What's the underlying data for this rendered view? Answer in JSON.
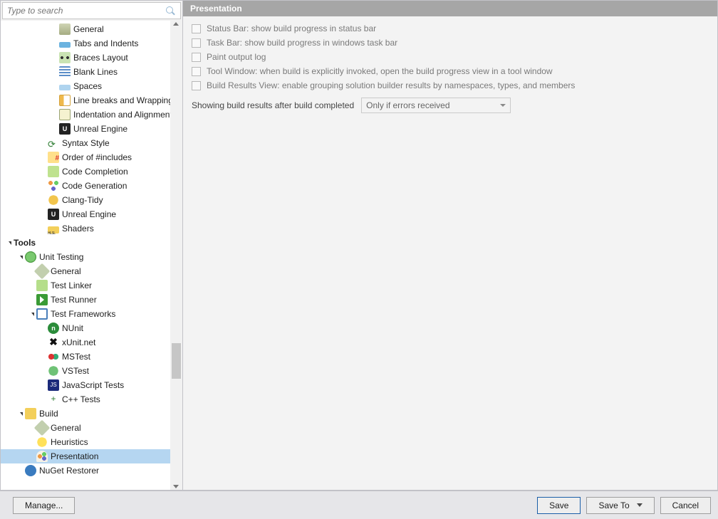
{
  "search": {
    "placeholder": "Type to search"
  },
  "tree": [
    {
      "d": 4,
      "icon": "i-gen",
      "label": "General"
    },
    {
      "d": 4,
      "icon": "i-tabs",
      "label": "Tabs and Indents"
    },
    {
      "d": 4,
      "icon": "i-braces",
      "label": "Braces Layout"
    },
    {
      "d": 4,
      "icon": "i-blank",
      "label": "Blank Lines"
    },
    {
      "d": 4,
      "icon": "i-spaces",
      "label": "Spaces"
    },
    {
      "d": 4,
      "icon": "i-wrap",
      "label": "Line breaks and Wrapping"
    },
    {
      "d": 4,
      "icon": "i-indent",
      "label": "Indentation and Alignment"
    },
    {
      "d": 4,
      "icon": "i-ue",
      "label": "Unreal Engine",
      "iconText": "U"
    },
    {
      "d": 3,
      "icon": "i-syntax",
      "label": "Syntax Style"
    },
    {
      "d": 3,
      "icon": "i-order",
      "label": "Order of #includes"
    },
    {
      "d": 3,
      "icon": "i-code-comp",
      "label": "Code Completion"
    },
    {
      "d": 3,
      "icon": "i-code-gen",
      "label": "Code Generation"
    },
    {
      "d": 3,
      "icon": "i-clang",
      "label": "Clang-Tidy"
    },
    {
      "d": 3,
      "icon": "i-ue",
      "label": "Unreal Engine",
      "iconText": "U"
    },
    {
      "d": 3,
      "icon": "i-shaders",
      "label": "Shaders"
    },
    {
      "d": 0,
      "caret": true,
      "bold": true,
      "label": "Tools"
    },
    {
      "d": 1,
      "caret": true,
      "icon": "i-unittest",
      "label": "Unit Testing"
    },
    {
      "d": 2,
      "icon": "i-wrench",
      "label": "General"
    },
    {
      "d": 2,
      "icon": "i-linker",
      "label": "Test Linker"
    },
    {
      "d": 2,
      "icon": "i-runner",
      "label": "Test Runner"
    },
    {
      "d": 2,
      "caret": true,
      "icon": "i-frameworks",
      "label": "Test Frameworks"
    },
    {
      "d": 3,
      "icon": "i-nunit",
      "label": "NUnit",
      "iconText": "n"
    },
    {
      "d": 3,
      "icon": "i-xunit",
      "label": "xUnit.net",
      "iconText": "✖"
    },
    {
      "d": 3,
      "icon": "i-mstest",
      "label": "MSTest"
    },
    {
      "d": 3,
      "icon": "i-vstest",
      "label": "VSTest"
    },
    {
      "d": 3,
      "icon": "i-js",
      "label": "JavaScript Tests",
      "iconText": "JS"
    },
    {
      "d": 3,
      "icon": "i-cpp",
      "label": "C++ Tests",
      "iconText": "+"
    },
    {
      "d": 1,
      "caret": true,
      "icon": "i-build",
      "label": "Build"
    },
    {
      "d": 2,
      "icon": "i-wrench",
      "label": "General"
    },
    {
      "d": 2,
      "icon": "i-bulb",
      "label": "Heuristics"
    },
    {
      "d": 2,
      "icon": "i-pres",
      "label": "Presentation",
      "selected": true
    },
    {
      "d": 1,
      "icon": "i-nuget",
      "label": "NuGet Restorer"
    }
  ],
  "panel": {
    "title": "Presentation",
    "checks": [
      "Status Bar: show build progress in status bar",
      "Task Bar: show build progress in windows task bar",
      "Paint output log",
      "Tool Window: when build is explicitly invoked, open the build progress view in a tool window",
      "Build Results View: enable grouping solution builder results by namespaces, types, and members"
    ],
    "select_label": "Showing build results after build completed",
    "select_value": "Only if errors received"
  },
  "footer": {
    "manage": "Manage...",
    "save": "Save",
    "saveTo": "Save To",
    "cancel": "Cancel"
  }
}
